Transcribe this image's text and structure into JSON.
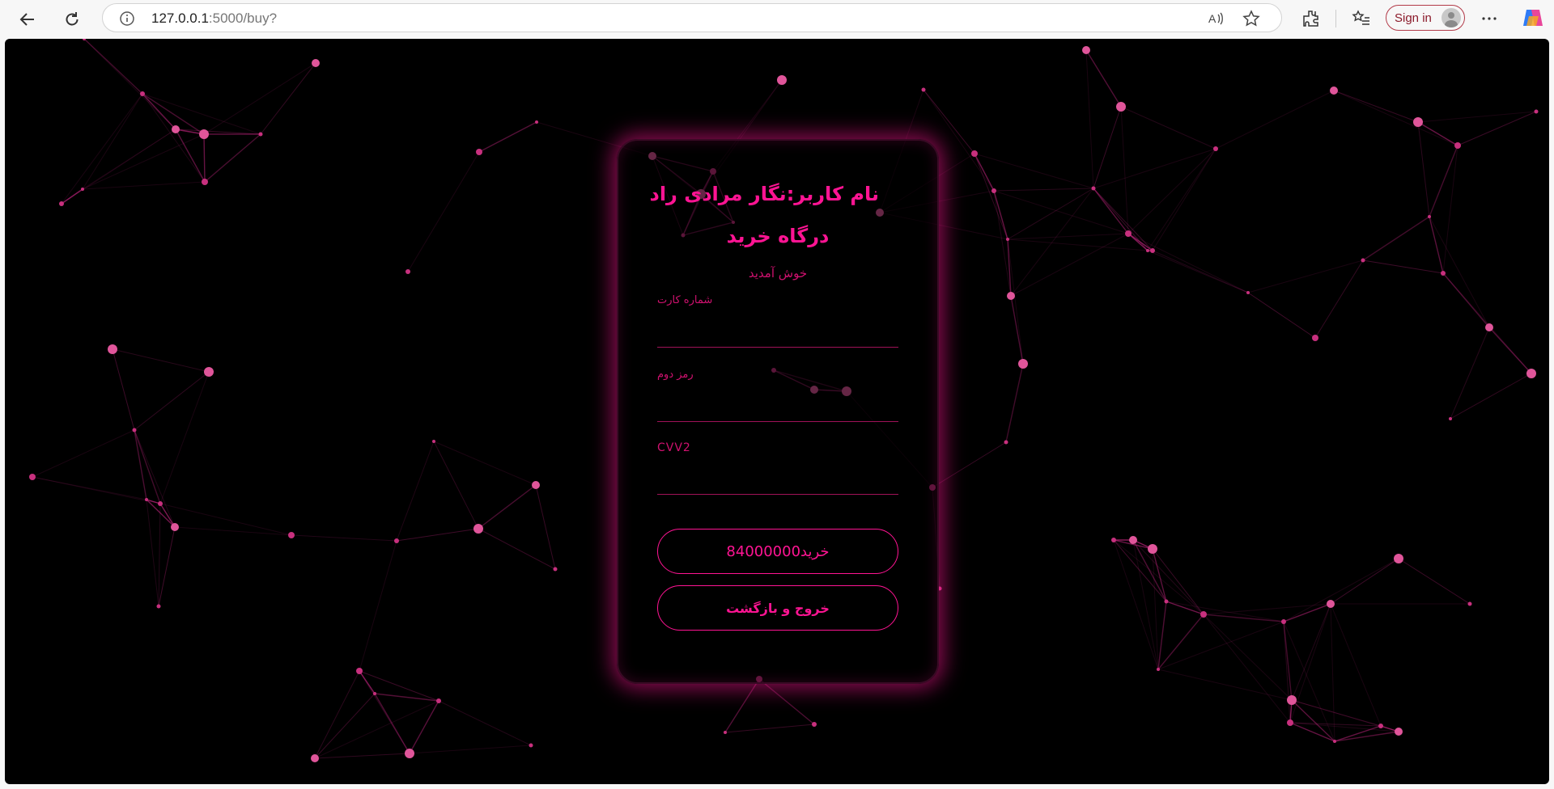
{
  "browser": {
    "url_host": "127.0.0.1",
    "url_rest": ":5000/buy?",
    "signin_label": "Sign in"
  },
  "page": {
    "title_user": "نام کاربر:نگار مرادی راد",
    "title_gateway": "درگاه خرید",
    "welcome": "خوش آمدید",
    "fields": {
      "card_number_label": "شماره کارت",
      "second_password_label": "رمز دوم",
      "cvv2_label": "CVV2"
    },
    "buy_button": "84000000خرید",
    "exit_button": "خروج و بازگشت"
  },
  "colors": {
    "accent": "#ff1493",
    "background": "#000000"
  }
}
